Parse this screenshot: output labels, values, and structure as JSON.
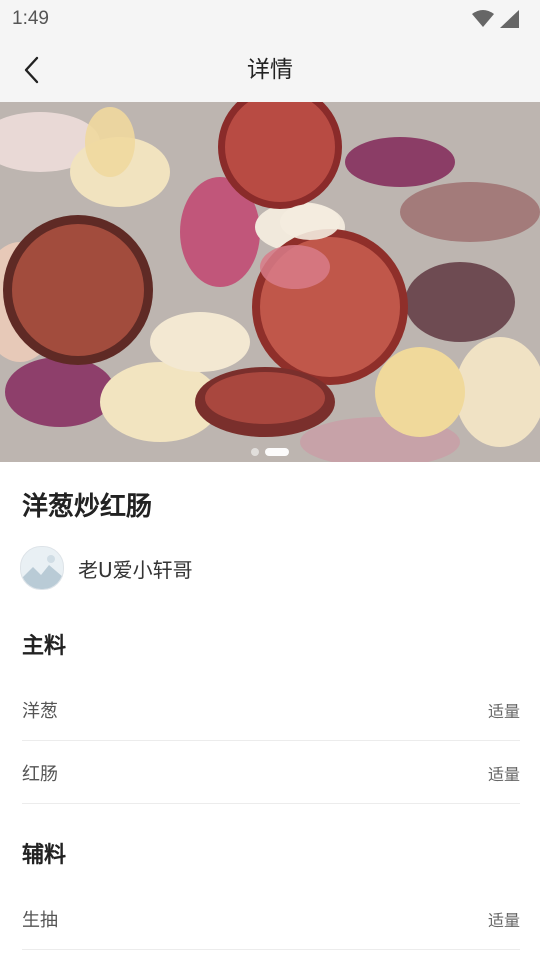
{
  "status_bar": {
    "time": "1:49"
  },
  "nav": {
    "title": "详情",
    "back_icon": "chevron-left-icon"
  },
  "hero": {
    "image_description": "stir-fried red sausage with onions",
    "slides": 2,
    "active_slide": 1
  },
  "recipe": {
    "title": "洋葱炒红肠",
    "author": "老U爱小轩哥",
    "main_ingredients": {
      "title": "主料",
      "items": [
        {
          "name": "洋葱",
          "qty": "适量"
        },
        {
          "name": "红肠",
          "qty": "适量"
        }
      ]
    },
    "side_ingredients": {
      "title": "辅料",
      "items": [
        {
          "name": "生抽",
          "qty": "适量"
        }
      ]
    }
  }
}
